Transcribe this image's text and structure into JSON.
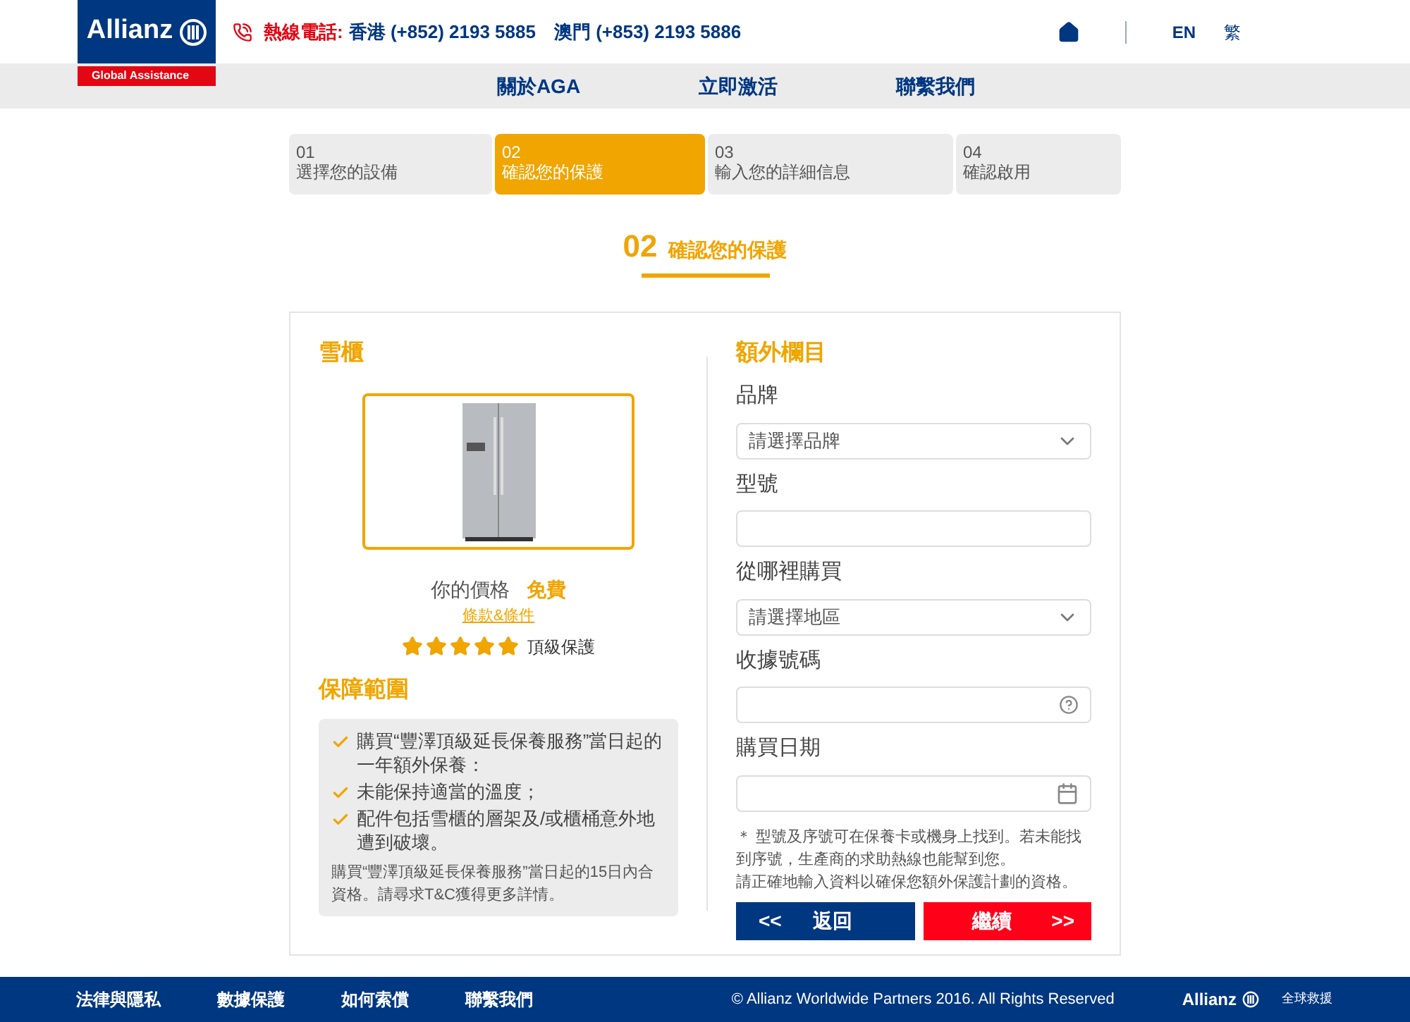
{
  "header": {
    "logo": "Allianz",
    "logo_sub": "Global Assistance",
    "hotline_label": "熱線電話:",
    "hotline": "香港 (+852) 2193 5885　澳門 (+853) 2193 5886",
    "languages": [
      "EN",
      "繁"
    ]
  },
  "nav": [
    "關於AGA",
    "立即激活",
    "聯繫我們"
  ],
  "steps": [
    {
      "number": "01",
      "label": "選擇您的設備",
      "selected": false
    },
    {
      "number": "02",
      "label": "確認您的保護",
      "selected": true
    },
    {
      "number": "03",
      "label": "輸入您的詳細信息",
      "selected": false
    },
    {
      "number": "04",
      "label": "確認啟用",
      "selected": false
    }
  ],
  "page_title": {
    "number": "02",
    "label": "確認您的保護"
  },
  "product": {
    "title": "雪櫃",
    "price_label": "你的價格",
    "price": "免費",
    "terms_link": "條款&條件",
    "stars": 5,
    "tier": "頂級保護"
  },
  "coverage": {
    "title": "保障範圍",
    "items": [
      "購買“豐澤頂級延長保養服務”當日起的一年額外保養：",
      "未能保持適當的溫度；",
      "配件包括雪櫃的層架及/或櫃桶意外地遭到破壞。"
    ],
    "note": "購買“豐澤頂級延長保養服務”當日起的15日內合資格。請尋求T&C獲得更多詳情。"
  },
  "extra": {
    "title": "額外欄目",
    "fields": [
      {
        "label": "品牌",
        "kind": "select",
        "placeholder": "請選擇品牌"
      },
      {
        "label": "型號",
        "kind": "text"
      },
      {
        "label": "從哪裡購買",
        "kind": "select",
        "placeholder": "請選擇地區"
      },
      {
        "label": "收據號碼",
        "kind": "help"
      },
      {
        "label": "購買日期",
        "kind": "date"
      }
    ],
    "notes": [
      "＊ 型號及序號可在保養卡或機身上找到。若未能找到序號，生產商的求助熱線也能幫到您。",
      "請正確地輸入資料以確保您額外保護計劃的資格。"
    ],
    "back": "返回",
    "continue": "繼續",
    "back_icon": "<<",
    "continue_icon": ">>"
  },
  "footer": {
    "links": [
      "法律與隱私",
      "數據保護",
      "如何索償",
      "聯繫我們"
    ],
    "copyright": "© Allianz Worldwide Partners 2016. All Rights Reserved",
    "logo": "Allianz",
    "logo_sub": "全球救援"
  }
}
